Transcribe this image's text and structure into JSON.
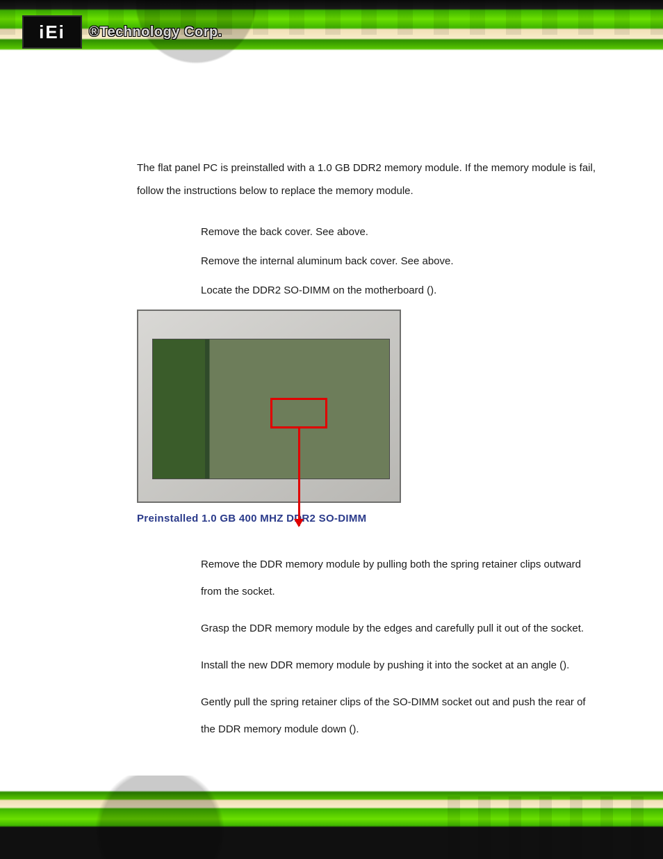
{
  "header": {
    "logo_abbrev": "iEi",
    "logo_text": "®Technology Corp."
  },
  "body": {
    "intro": "The flat panel PC is preinstalled with a 1.0 GB DDR2 memory module. If the memory module is fail, follow the instructions below to replace the memory module.",
    "steps_a": [
      {
        "text_pre": "Remove the back cover. See ",
        "text_post": " above."
      },
      {
        "text_pre": "Remove the internal aluminum back cover. See ",
        "text_post": " above."
      },
      {
        "text_pre": "Locate the DDR2 SO-DIMM on the motherboard (",
        "text_post": ")."
      }
    ],
    "figure_caption": "Preinstalled 1.0 GB 400 MHZ DDR2 SO-DIMM",
    "steps_b": [
      "Remove the DDR memory module by pulling both the spring retainer clips outward from the socket.",
      "Grasp the DDR memory module by the edges and carefully pull it out of the socket.",
      {
        "text_pre": "Install the new DDR memory module by pushing it into the socket at an angle (",
        "text_post": ")."
      },
      {
        "text_pre": "Gently pull the spring retainer clips of the SO-DIMM socket out and push the rear of the DDR memory module down (",
        "text_post": ")."
      }
    ]
  }
}
